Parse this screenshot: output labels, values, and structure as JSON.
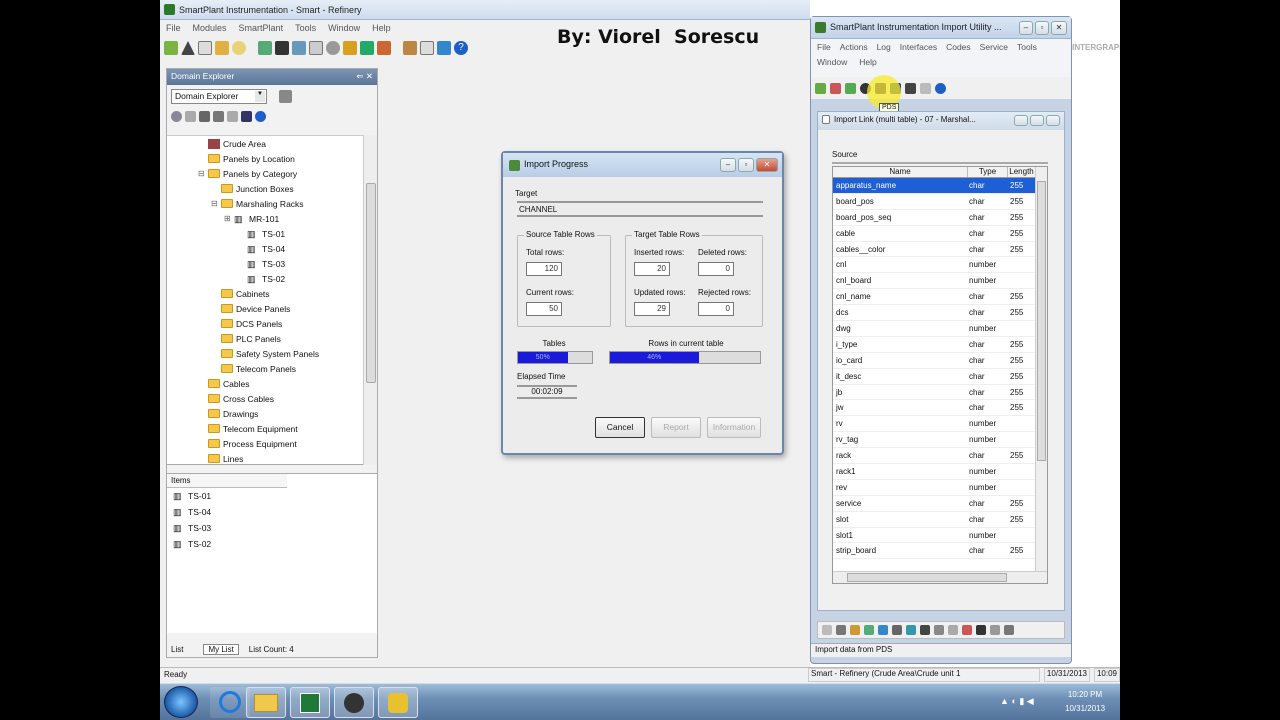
{
  "main_window": {
    "title": "SmartPlant Instrumentation - Smart - Refinery",
    "menu": [
      "File",
      "Modules",
      "SmartPlant",
      "Tools",
      "Window",
      "Help"
    ],
    "status_left": "Ready",
    "status_mid": "Smart - Refinery (Crude Area\\Crude unit 1",
    "status_date": "10/31/2013",
    "status_time": "10:09"
  },
  "watermark": "By: Viorel  Sorescu",
  "domain_explorer": {
    "title": "Domain Explorer",
    "dropdown_value": "Domain Explorer",
    "tree": [
      {
        "label": "Crude Area",
        "indent": 1,
        "icon": "area",
        "exp": ""
      },
      {
        "label": "Panels by Location",
        "indent": 1,
        "icon": "folder",
        "exp": ""
      },
      {
        "label": "Panels by Category",
        "indent": 1,
        "icon": "folder",
        "exp": "⊟"
      },
      {
        "label": "Junction Boxes",
        "indent": 2,
        "icon": "folder",
        "exp": ""
      },
      {
        "label": "Marshaling Racks",
        "indent": 2,
        "icon": "folder",
        "exp": "⊟"
      },
      {
        "label": "MR-101",
        "indent": 3,
        "icon": "rack",
        "exp": "⊞"
      },
      {
        "label": "TS-01",
        "indent": 4,
        "icon": "rack",
        "exp": ""
      },
      {
        "label": "TS-04",
        "indent": 4,
        "icon": "rack",
        "exp": ""
      },
      {
        "label": "TS-03",
        "indent": 4,
        "icon": "rack",
        "exp": ""
      },
      {
        "label": "TS-02",
        "indent": 4,
        "icon": "rack",
        "exp": ""
      },
      {
        "label": "Cabinets",
        "indent": 2,
        "icon": "folder",
        "exp": ""
      },
      {
        "label": "Device Panels",
        "indent": 2,
        "icon": "folder",
        "exp": ""
      },
      {
        "label": "DCS Panels",
        "indent": 2,
        "icon": "folder",
        "exp": ""
      },
      {
        "label": "PLC Panels",
        "indent": 2,
        "icon": "folder",
        "exp": ""
      },
      {
        "label": "Safety System Panels",
        "indent": 2,
        "icon": "folder",
        "exp": ""
      },
      {
        "label": "Telecom Panels",
        "indent": 2,
        "icon": "folder",
        "exp": ""
      },
      {
        "label": "Cables",
        "indent": 1,
        "icon": "folder",
        "exp": ""
      },
      {
        "label": "Cross Cables",
        "indent": 1,
        "icon": "folder",
        "exp": ""
      },
      {
        "label": "Drawings",
        "indent": 1,
        "icon": "folder",
        "exp": ""
      },
      {
        "label": "Telecom Equipment",
        "indent": 1,
        "icon": "folder",
        "exp": ""
      },
      {
        "label": "Process Equipment",
        "indent": 1,
        "icon": "folder",
        "exp": ""
      },
      {
        "label": "Lines",
        "indent": 1,
        "icon": "folder",
        "exp": ""
      }
    ],
    "items_header": "Items",
    "items": [
      "TS-01",
      "TS-04",
      "TS-03",
      "TS-02"
    ],
    "tabs": [
      "List",
      "My List"
    ],
    "list_count": "List Count: 4"
  },
  "import_progress": {
    "title": "Import Progress",
    "target_label": "Target",
    "target_value": "CHANNEL",
    "source_group": "Source Table Rows",
    "target_group": "Target Table Rows",
    "total_rows_label": "Total rows:",
    "total_rows": "120",
    "current_rows_label": "Current rows:",
    "current_rows": "50",
    "inserted_label": "Inserted rows:",
    "inserted": "20",
    "deleted_label": "Deleted rows:",
    "deleted": "0",
    "updated_label": "Updated rows:",
    "updated": "29",
    "rejected_label": "Rejected rows:",
    "rejected": "0",
    "tables_label": "Tables",
    "tables_text": "50%",
    "tables_progress": 0.67,
    "rows_label": "Rows in current table",
    "rows_text": "46%",
    "rows_progress": 0.59,
    "elapsed_label": "Elapsed Time",
    "elapsed_value": "00:02:09",
    "cancel": "Cancel",
    "report": "Report",
    "information": "Information"
  },
  "import_utility": {
    "title": "SmartPlant Instrumentation Import Utility ...",
    "menu": [
      "File",
      "Actions",
      "Log",
      "Interfaces",
      "Codes",
      "Service",
      "Tools"
    ],
    "menu2": [
      "Window",
      "Help"
    ],
    "logo": "INTERGRAPH",
    "tooltip": "PDS",
    "link_title": "Import Link (multi table) - 07 - Marshal...",
    "source_label": "Source",
    "columns": [
      "Name",
      "Type",
      "Length"
    ],
    "rows": [
      [
        "apparatus_name",
        "char",
        "255"
      ],
      [
        "board_pos",
        "char",
        "255"
      ],
      [
        "board_pos_seq",
        "char",
        "255"
      ],
      [
        "cable",
        "char",
        "255"
      ],
      [
        "cables__color",
        "char",
        "255"
      ],
      [
        "cnl",
        "number",
        ""
      ],
      [
        "cnl_board",
        "number",
        ""
      ],
      [
        "cnl_name",
        "char",
        "255"
      ],
      [
        "dcs",
        "char",
        "255"
      ],
      [
        "dwg",
        "number",
        ""
      ],
      [
        "i_type",
        "char",
        "255"
      ],
      [
        "io_card",
        "char",
        "255"
      ],
      [
        "it_desc",
        "char",
        "255"
      ],
      [
        "jb",
        "char",
        "255"
      ],
      [
        "jw",
        "char",
        "255"
      ],
      [
        "rv",
        "number",
        ""
      ],
      [
        "rv_tag",
        "number",
        ""
      ],
      [
        "rack",
        "char",
        "255"
      ],
      [
        "rack1",
        "number",
        ""
      ],
      [
        "rev",
        "number",
        ""
      ],
      [
        "service",
        "char",
        "255"
      ],
      [
        "slot",
        "char",
        "255"
      ],
      [
        "slot1",
        "number",
        ""
      ],
      [
        "strip_board",
        "char",
        "255"
      ]
    ],
    "status": "Import data from PDS"
  },
  "taskbar": {
    "time": "10:20 PM",
    "date": "10/31/2013"
  },
  "colors": {
    "progress": "#1a1ad8",
    "selection": "#1f5fd6",
    "folder": "#f5c84c"
  }
}
